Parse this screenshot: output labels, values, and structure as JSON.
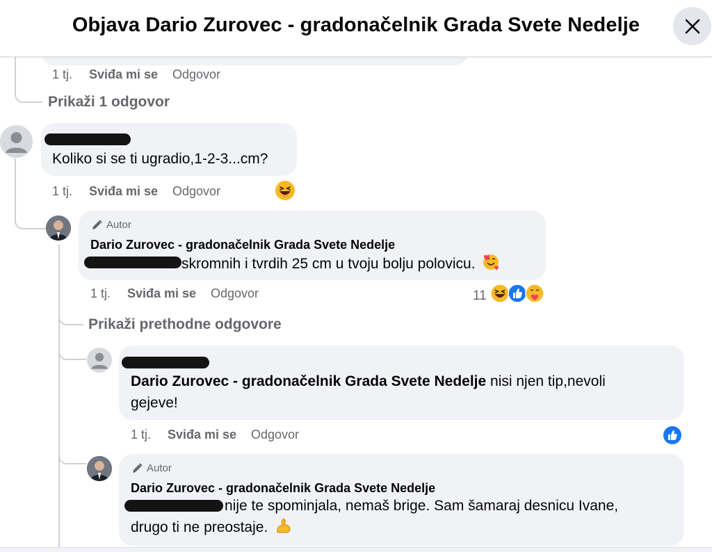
{
  "header": {
    "title": "Objava Dario Zurovec - gradonačelnik Grada Svete Nedelje"
  },
  "comments": {
    "c0": {
      "time": "1 tj.",
      "like": "Sviđa mi se",
      "reply": "Odgovor"
    },
    "show_one_reply": "Prikaži 1 odgovor",
    "c1": {
      "text": "Koliko si se ti ugradio,1-2-3...cm?",
      "time": "1 tj.",
      "like": "Sviđa mi se",
      "reply": "Odgovor"
    },
    "c2": {
      "badge": "Autor",
      "author": "Dario Zurovec - gradonačelnik Grada Svete Nedelje",
      "text": "skromnih i tvrdih 25 cm u tvoju bolju polovicu.",
      "time": "1 tj.",
      "like": "Sviđa mi se",
      "reply": "Odgovor",
      "reaction_count": "11"
    },
    "show_previous": "Prikaži prethodne odgovore",
    "c3": {
      "mention": "Dario Zurovec - gradonačelnik Grada Svete Nedelje",
      "text_line1": "nisi njen tip,nevoli",
      "text_line2": "gejeve!",
      "time": "1 tj.",
      "like": "Sviđa mi se",
      "reply": "Odgovor"
    },
    "c4": {
      "badge": "Autor",
      "author": "Dario Zurovec - gradonačelnik Grada Svete Nedelje",
      "text_line1": "nije te spominjala, nemaš brige. Sam šamaraj desnicu Ivane,",
      "text_line2": "drugo ti ne preostaje."
    }
  },
  "colors": {
    "bubble": "#f0f2f5",
    "meta": "#65676b",
    "like_blue": "#1877f2",
    "haha_yellow": "#f7b928"
  },
  "icons": [
    "close-icon",
    "pen-icon",
    "haha-emoji-icon",
    "like-reaction-icon",
    "care-emoji-icon",
    "smiling-hearts-emoji-icon",
    "flexed-biceps-emoji-icon",
    "default-avatar-icon"
  ]
}
